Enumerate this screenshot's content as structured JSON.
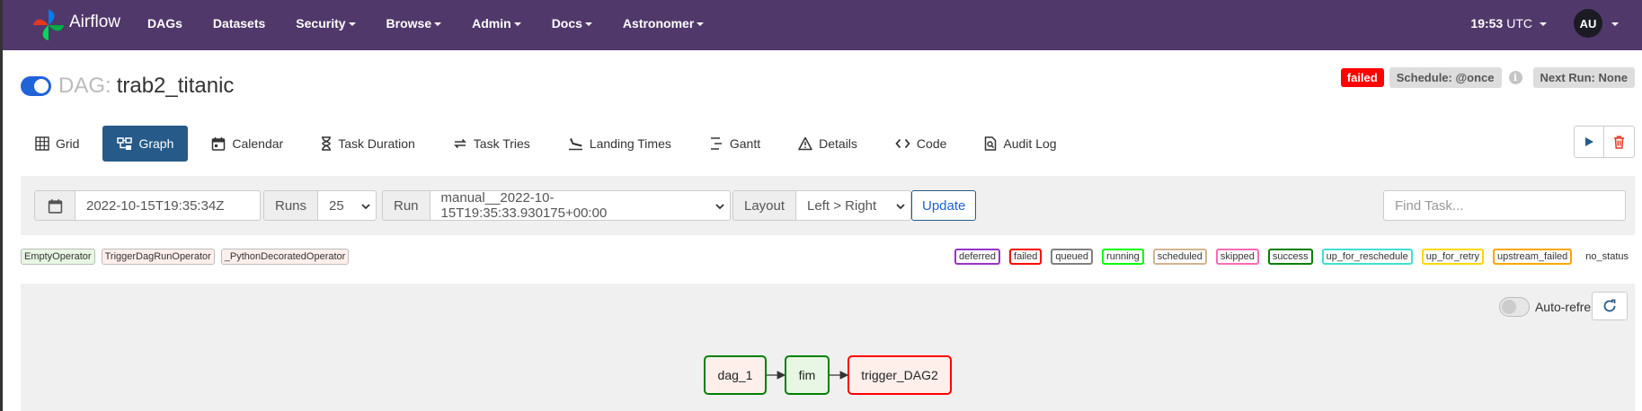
{
  "navbar": {
    "brand": "Airflow",
    "items": [
      {
        "label": "DAGs",
        "dropdown": false
      },
      {
        "label": "Datasets",
        "dropdown": false
      },
      {
        "label": "Security",
        "dropdown": true
      },
      {
        "label": "Browse",
        "dropdown": true
      },
      {
        "label": "Admin",
        "dropdown": true
      },
      {
        "label": "Docs",
        "dropdown": true
      },
      {
        "label": "Astronomer",
        "dropdown": true
      }
    ],
    "time": "19:53",
    "timezone": "UTC",
    "user_initials": "AU"
  },
  "dag": {
    "label": "DAG:",
    "id": "trab2_titanic",
    "paused": false,
    "status": "failed",
    "schedule": "Schedule: @once",
    "next_run": "Next Run: None"
  },
  "tabs": [
    {
      "label": "Grid",
      "icon": "grid-icon"
    },
    {
      "label": "Graph",
      "icon": "graph-icon",
      "active": true
    },
    {
      "label": "Calendar",
      "icon": "calendar-icon"
    },
    {
      "label": "Task Duration",
      "icon": "hourglass-icon"
    },
    {
      "label": "Task Tries",
      "icon": "retry-icon"
    },
    {
      "label": "Landing Times",
      "icon": "plane-landing-icon"
    },
    {
      "label": "Gantt",
      "icon": "gantt-icon"
    },
    {
      "label": "Details",
      "icon": "warning-triangle-icon"
    },
    {
      "label": "Code",
      "icon": "code-icon"
    },
    {
      "label": "Audit Log",
      "icon": "audit-log-icon"
    }
  ],
  "filters": {
    "date_value": "2022-10-15T19:35:34Z",
    "runs_label": "Runs",
    "runs_value": "25",
    "run_label": "Run",
    "run_value": "manual__2022-10-15T19:35:33.930175+00:00",
    "layout_label": "Layout",
    "layout_value": "Left > Right",
    "update_label": "Update",
    "find_task_placeholder": "Find Task..."
  },
  "operator_legend": [
    {
      "label": "EmptyOperator",
      "color": "#e8f7e4"
    },
    {
      "label": "TriggerDagRunOperator",
      "color": "#ffefeb"
    },
    {
      "label": "_PythonDecoratedOperator",
      "color": "#ffefeb"
    }
  ],
  "state_legend": [
    {
      "label": "deferred",
      "color": "#9932cc"
    },
    {
      "label": "failed",
      "color": "#ff0000"
    },
    {
      "label": "queued",
      "color": "#808080"
    },
    {
      "label": "running",
      "color": "#00ff00"
    },
    {
      "label": "scheduled",
      "color": "#d2b48c"
    },
    {
      "label": "skipped",
      "color": "#ff69b4"
    },
    {
      "label": "success",
      "color": "#008000"
    },
    {
      "label": "up_for_reschedule",
      "color": "#40e0d0"
    },
    {
      "label": "up_for_retry",
      "color": "#ffd700"
    },
    {
      "label": "upstream_failed",
      "color": "#ffa500"
    },
    {
      "label": "no_status",
      "color": ""
    }
  ],
  "graph": {
    "auto_refresh_label": "Auto-refresh",
    "auto_refresh_on": false,
    "nodes": [
      {
        "id": "dag_1",
        "fill": "#ffefeb",
        "border": "#008000"
      },
      {
        "id": "fim",
        "fill": "#e8f7e4",
        "border": "#008000"
      },
      {
        "id": "trigger_DAG2",
        "fill": "#ffefeb",
        "border": "#ff0000"
      }
    ]
  }
}
